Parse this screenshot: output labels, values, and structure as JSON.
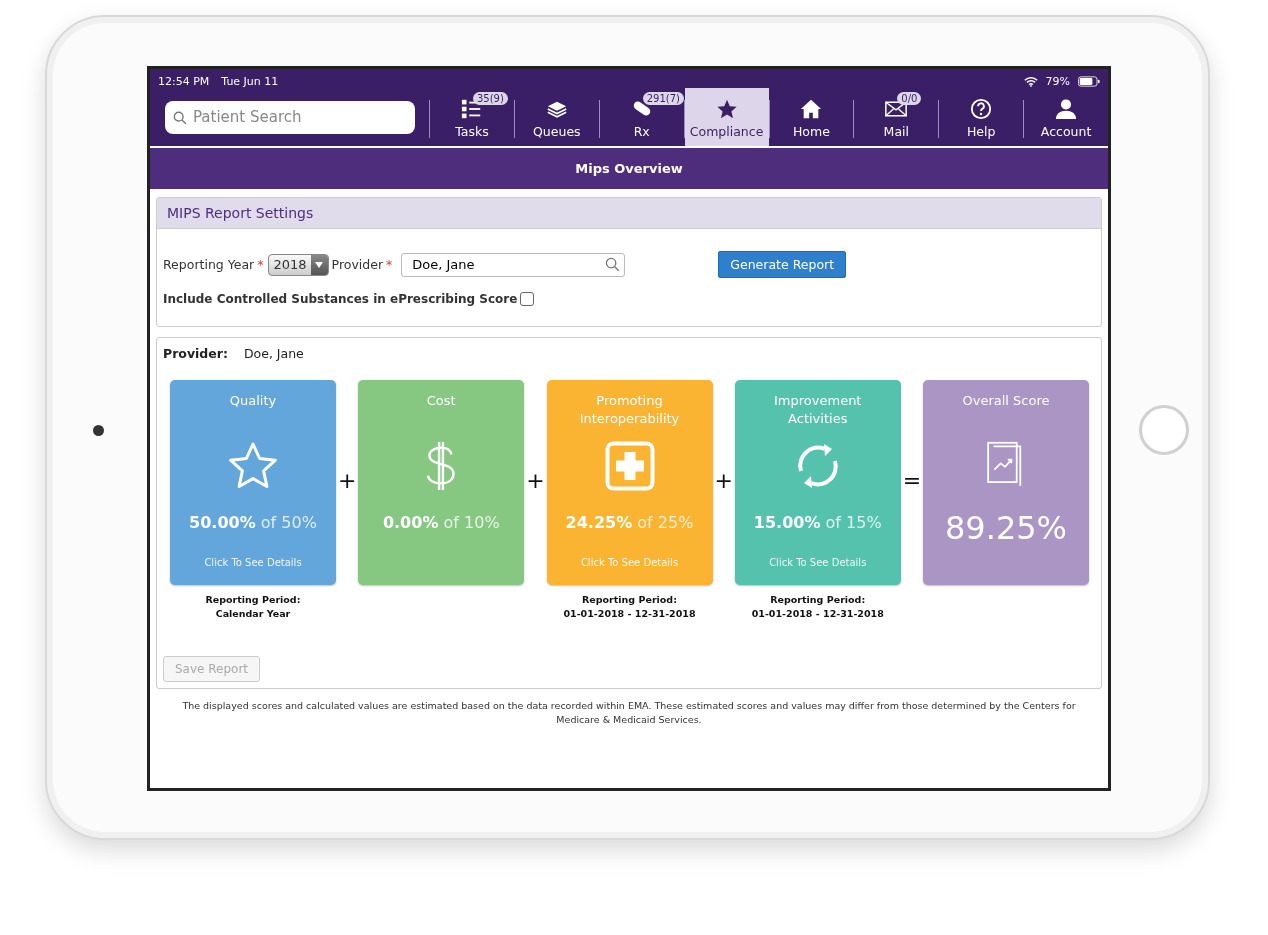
{
  "status_bar": {
    "time": "12:54 PM",
    "date": "Tue Jun 11",
    "battery": "79%"
  },
  "search": {
    "placeholder": "Patient Search"
  },
  "nav": [
    {
      "label": "Tasks",
      "badge": "35(9)",
      "selected": false
    },
    {
      "label": "Queues",
      "selected": false
    },
    {
      "label": "Rx",
      "badge": "291(7)",
      "selected": false
    },
    {
      "label": "Compliance",
      "selected": true
    },
    {
      "label": "Home",
      "selected": false
    },
    {
      "label": "Mail",
      "badge": "0/0",
      "selected": false
    },
    {
      "label": "Help",
      "selected": false
    },
    {
      "label": "Account",
      "selected": false
    }
  ],
  "page_title": "Mips Overview",
  "settings": {
    "title": "MIPS Report Settings",
    "year_label": "Reporting Year",
    "year_required": "*",
    "year": "2018",
    "provider_label": "Provider",
    "provider_required": "*",
    "provider": "Doe, Jane",
    "generate_button": "Generate Report",
    "controlled_label": "Include Controlled Substances in ePrescribing Score",
    "controlled_checked": false
  },
  "report": {
    "provider_label": "Provider:",
    "provider": "Doe, Jane",
    "cards": [
      {
        "kind": "category",
        "title": "Quality",
        "color": "#63a6dc",
        "score": "50.00%",
        "of": "of 50%",
        "details": "Click To See Details",
        "period_label": "Reporting Period:",
        "period": "Calendar Year",
        "operator": "+"
      },
      {
        "kind": "category",
        "title": "Cost",
        "color": "#86c882",
        "score": "0.00%",
        "of": "of 10%",
        "operator": "+"
      },
      {
        "kind": "category",
        "title": "Promoting Interoperability",
        "color": "#fbb431",
        "score": "24.25%",
        "of": "of 25%",
        "details": "Click To See Details",
        "period_label": "Reporting Period:",
        "period": "01-01-2018 - 12-31-2018",
        "operator": "+"
      },
      {
        "kind": "category",
        "title": "Improvement Activities",
        "color": "#55c2ae",
        "score": "15.00%",
        "of": "of 15%",
        "details": "Click To See Details",
        "period_label": "Reporting Period:",
        "period": "01-01-2018 - 12-31-2018",
        "operator": "="
      },
      {
        "kind": "total",
        "title": "Overall Score",
        "color": "#ab95c5",
        "score": "89.25%"
      }
    ],
    "save_button": "Save Report",
    "save_disabled": true
  },
  "disclaimer": "The displayed scores and calculated values are estimated based on the data recorded within EMA. These estimated scores and values may differ from those determined by the Centers for Medicare & Medicaid Services."
}
